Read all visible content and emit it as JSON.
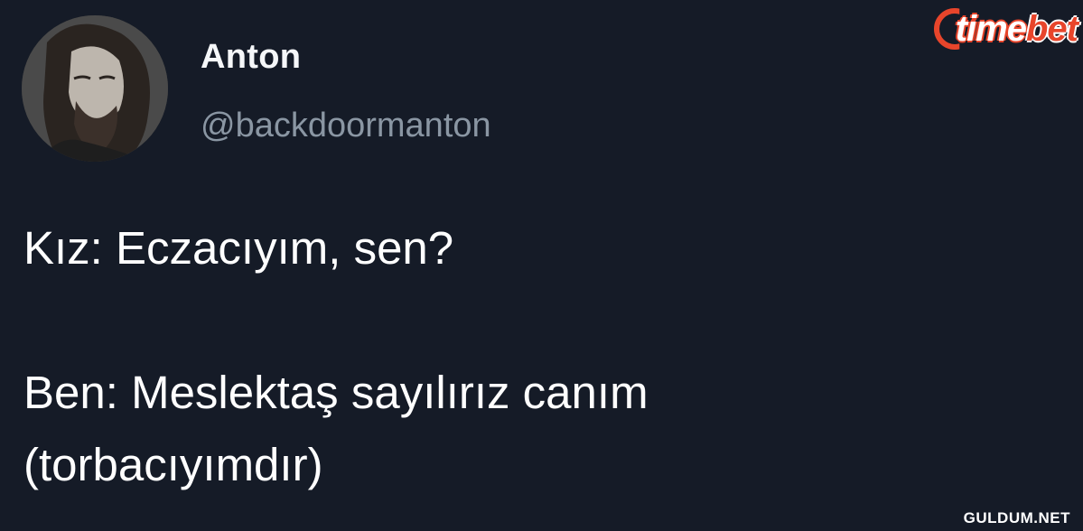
{
  "author": {
    "name": "Anton",
    "handle": "@backdoormanton"
  },
  "tweet": {
    "line1": "Kız: Eczacıyım, sen?",
    "line2": "Ben: Meslektaş sayılırız canım",
    "line3": "(torbacıyımdır)"
  },
  "brand": {
    "logo_text_part1": "time",
    "logo_text_part2": "bet"
  },
  "watermark": "GULDUM.NET",
  "colors": {
    "background": "#151b27",
    "handle": "#8a96a3",
    "brand_accent": "#e8452b"
  }
}
